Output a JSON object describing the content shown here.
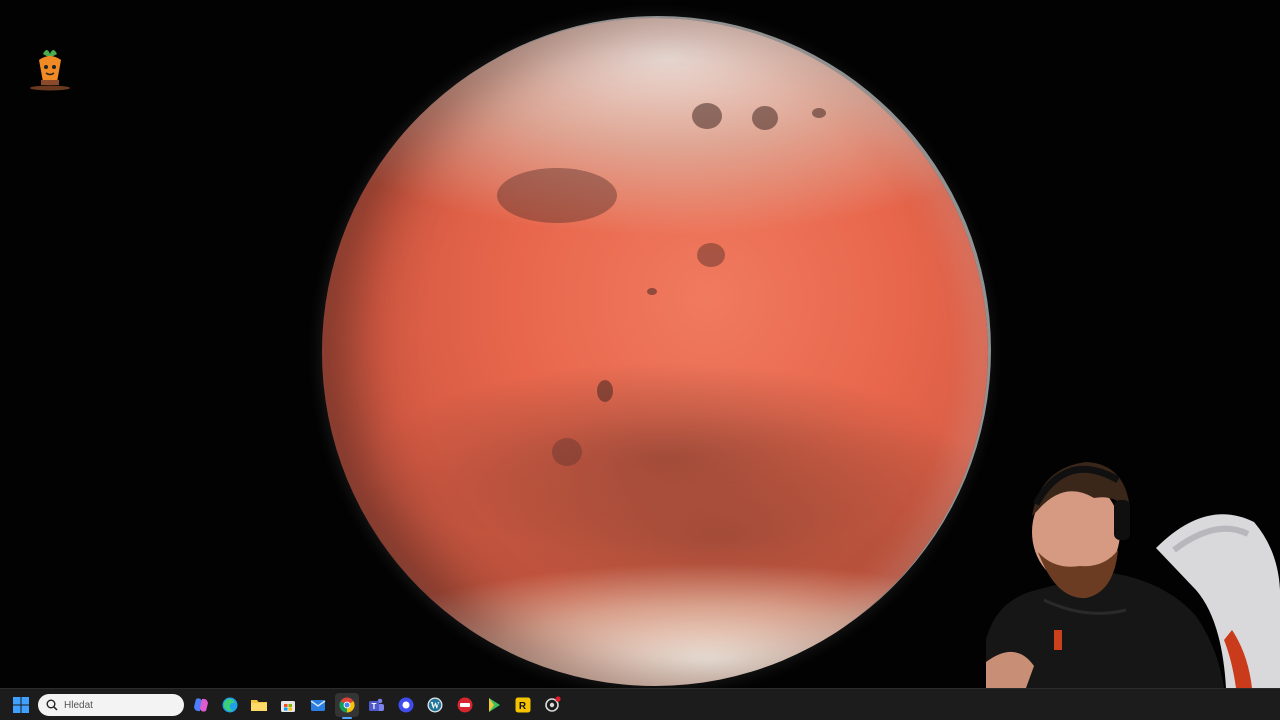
{
  "desktop": {
    "wallpaper": "mars-planet-wallpaper",
    "icons": [
      {
        "name": "carrot-app-icon"
      }
    ]
  },
  "overlay": {
    "webcam": "streamer-webcam"
  },
  "taskbar": {
    "search": {
      "placeholder": "Hledat"
    },
    "pinned": [
      {
        "id": "start",
        "icon": "windows-logo-icon"
      },
      {
        "id": "copilot",
        "icon": "copilot-icon"
      },
      {
        "id": "edge",
        "icon": "edge-icon"
      },
      {
        "id": "file-explorer",
        "icon": "folder-icon"
      },
      {
        "id": "microsoft-store",
        "icon": "store-icon"
      },
      {
        "id": "mail",
        "icon": "mail-icon"
      },
      {
        "id": "chrome",
        "icon": "chrome-icon"
      },
      {
        "id": "teams",
        "icon": "teams-icon"
      },
      {
        "id": "app-blue-circle",
        "icon": "blue-circle-app-icon"
      },
      {
        "id": "wordpress",
        "icon": "wordpress-icon"
      },
      {
        "id": "streamlabs",
        "icon": "red-record-icon"
      },
      {
        "id": "media-player",
        "icon": "green-play-icon"
      },
      {
        "id": "rockstar",
        "icon": "rockstar-launcher-icon"
      },
      {
        "id": "app-settings",
        "icon": "gear-badge-icon"
      }
    ]
  },
  "colors": {
    "taskbar_bg": "#1c1c1c",
    "mars_orange": "#e8674c",
    "windows_blue": "#1e90ff"
  }
}
